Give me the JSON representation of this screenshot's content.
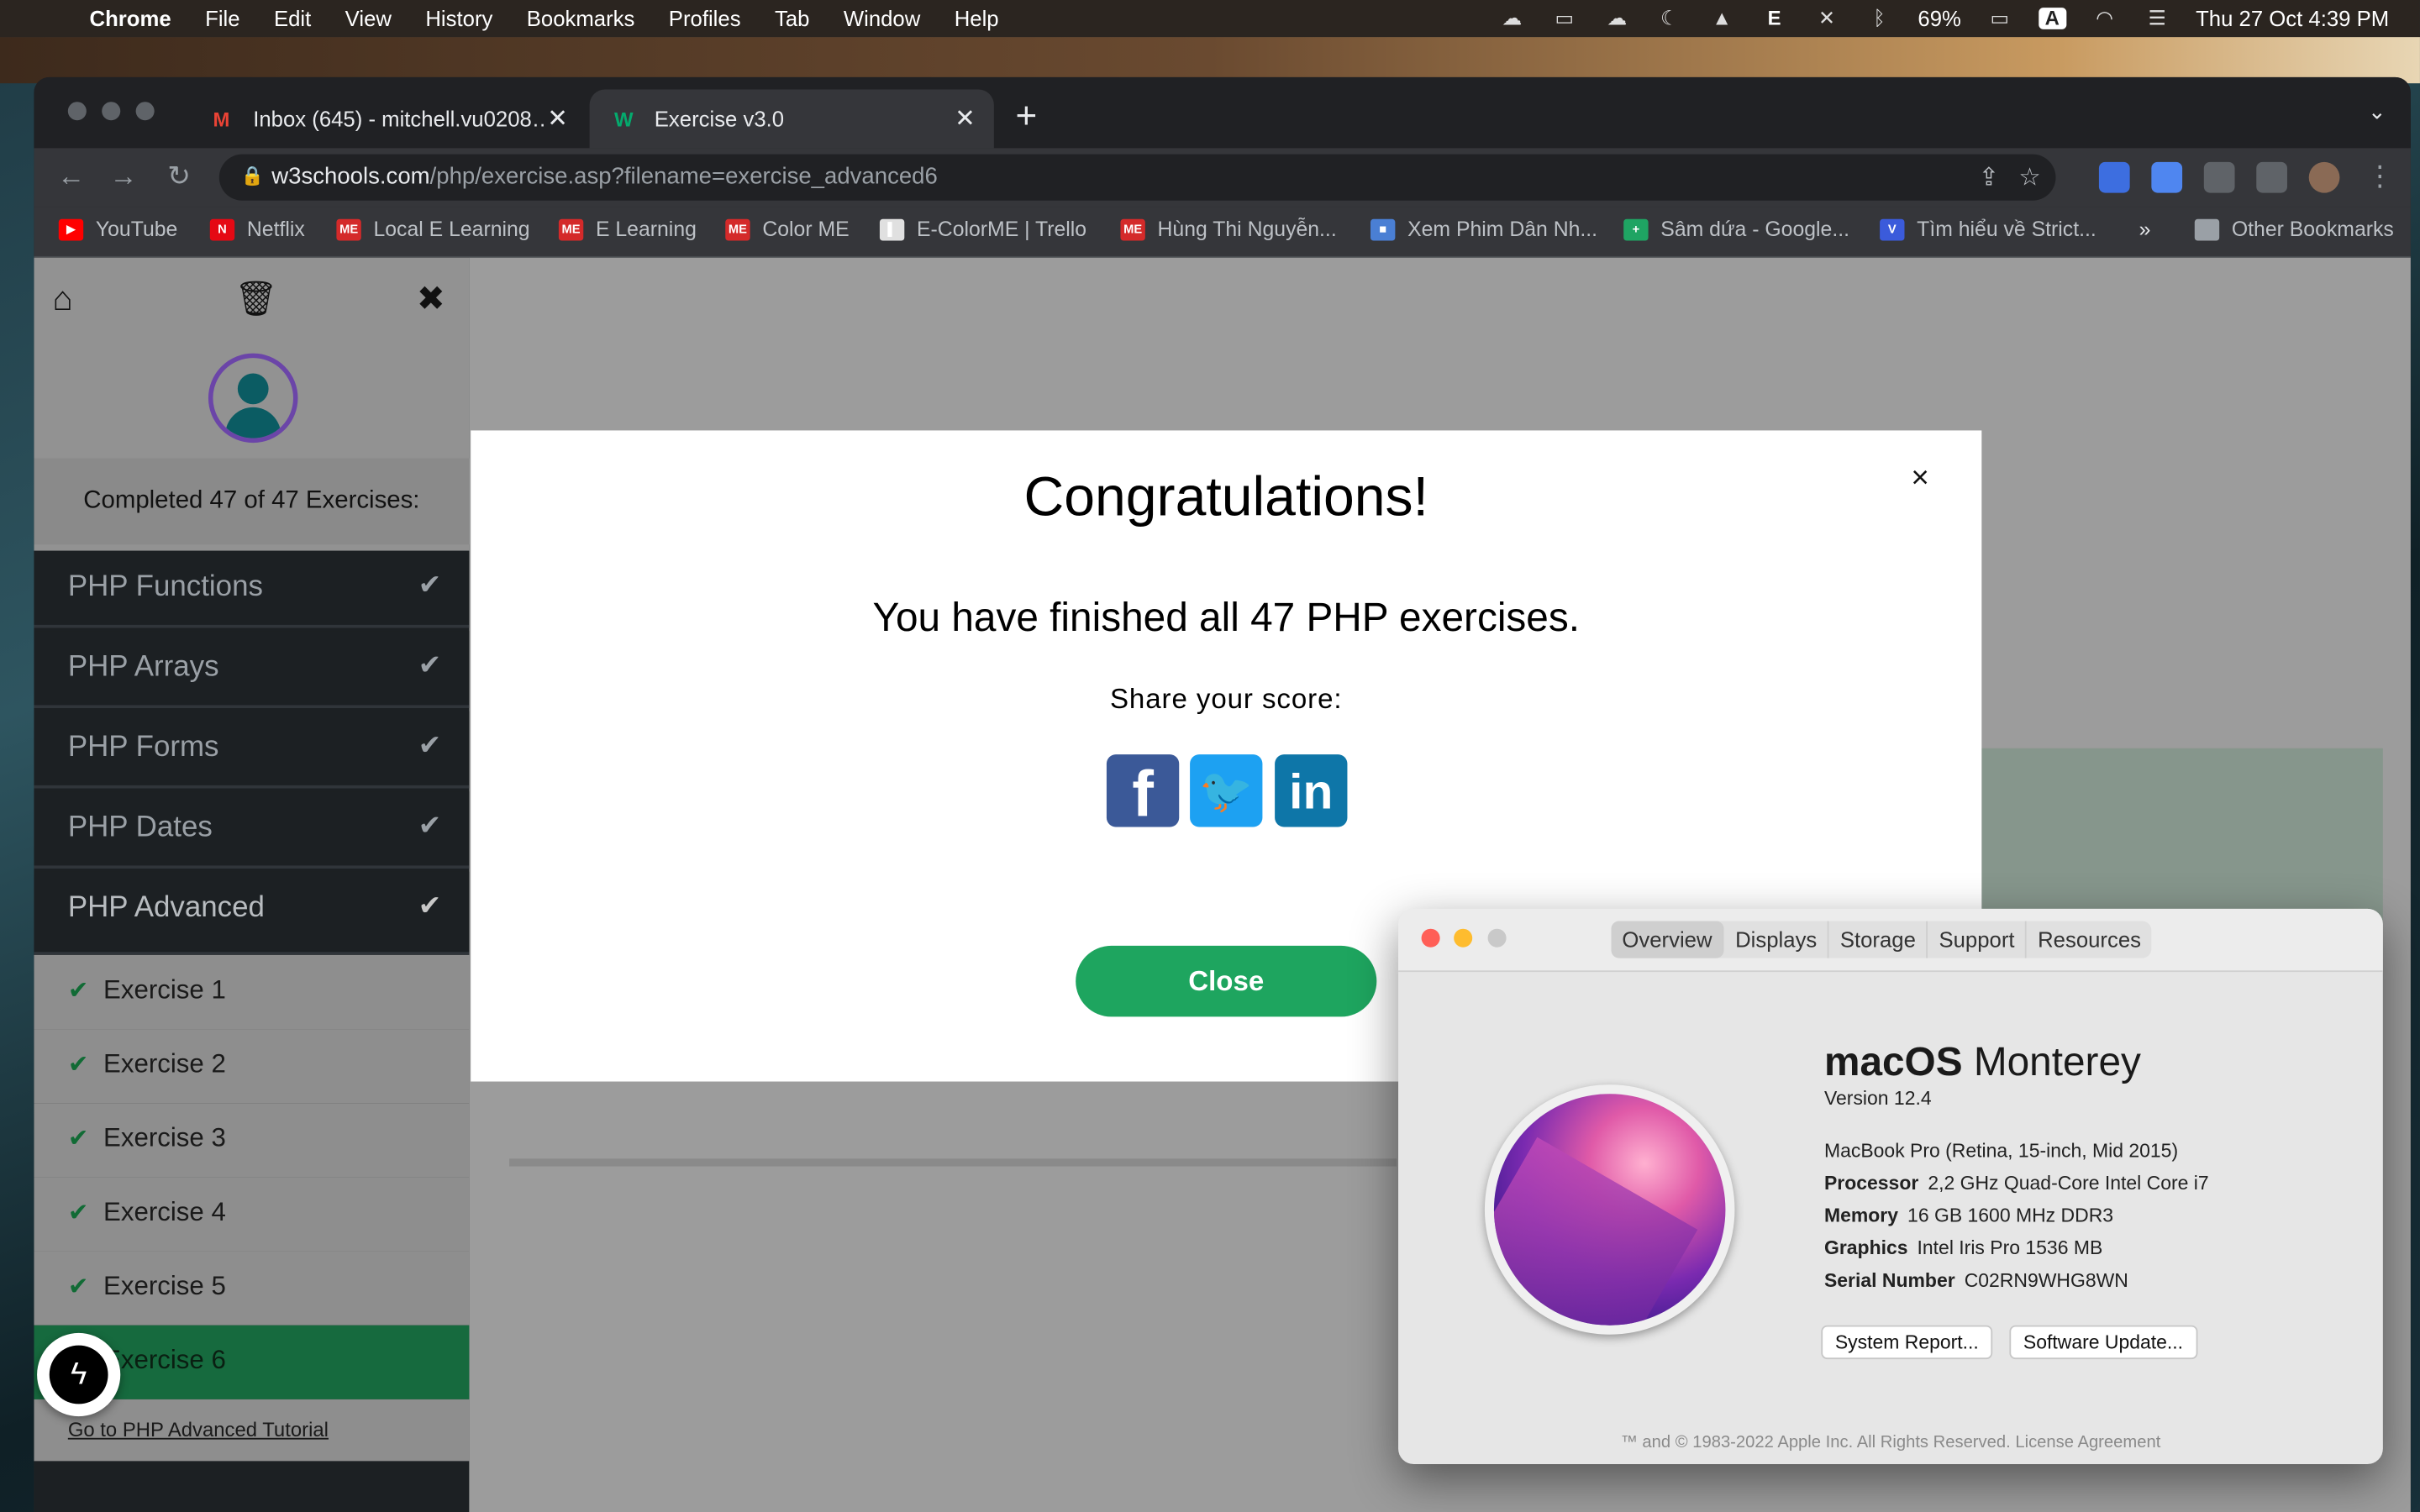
{
  "menubar": {
    "app": "Chrome",
    "items": [
      "File",
      "Edit",
      "View",
      "History",
      "Bookmarks",
      "Profiles",
      "Tab",
      "Window",
      "Help"
    ],
    "battery": "69%",
    "clock": "Thu 27 Oct  4:39 PM"
  },
  "tabs": [
    {
      "title": "Inbox (645) - mitchell.vu0208…",
      "icon": "gmail-icon"
    },
    {
      "title": "Exercise v3.0",
      "icon": "w3schools-icon"
    }
  ],
  "address": {
    "host": "w3schools.com",
    "path": "/php/exercise.asp?filename=exercise_advanced6"
  },
  "bookmarks": [
    {
      "label": "YouTube",
      "color": "#ff0000",
      "glyph": "▶"
    },
    {
      "label": "Netflix",
      "color": "#e50914",
      "glyph": "N"
    },
    {
      "label": "Local E Learning",
      "color": "#d42a2a",
      "glyph": "ME"
    },
    {
      "label": "E Learning",
      "color": "#d42a2a",
      "glyph": "ME"
    },
    {
      "label": "Color ME",
      "color": "#d42a2a",
      "glyph": "ME"
    },
    {
      "label": "E-ColorME | Trello",
      "color": "#e0e0e0",
      "glyph": "▌"
    },
    {
      "label": "Hùng Thi Nguyễn...",
      "color": "#d42a2a",
      "glyph": "ME"
    },
    {
      "label": "Xem Phim Dân Nh...",
      "color": "#4a7fd4",
      "glyph": "■"
    },
    {
      "label": "Sâm dứa - Google...",
      "color": "#1fa463",
      "glyph": "+"
    },
    {
      "label": "Tìm hiểu về Strict...",
      "color": "#3b5bdb",
      "glyph": "V"
    }
  ],
  "other_bookmarks": "Other Bookmarks",
  "sidebar": {
    "completed": "Completed 47 of 47 Exercises:",
    "categories": [
      "PHP Functions",
      "PHP Arrays",
      "PHP Forms",
      "PHP Dates",
      "PHP Advanced"
    ],
    "exercises": [
      "Exercise 1",
      "Exercise 2",
      "Exercise 3",
      "Exercise 4",
      "Exercise 5",
      "Exercise 6"
    ],
    "tutorial_link": "Go to PHP Advanced Tutorial"
  },
  "modal": {
    "title": "Congratulations!",
    "message": "You have finished all 47 PHP exercises.",
    "share": "Share your score:",
    "close": "Close",
    "close_x": "×",
    "social": {
      "facebook": "f",
      "twitter": "🐦",
      "linkedin": "in"
    }
  },
  "about": {
    "tabs": [
      "Overview",
      "Displays",
      "Storage",
      "Support",
      "Resources"
    ],
    "os_bold": "macOS",
    "os_light": " Monterey",
    "version": "Version 12.4",
    "model": "MacBook Pro (Retina, 15-inch, Mid 2015)",
    "specs": [
      {
        "label": "Processor",
        "value": "2,2 GHz Quad-Core Intel Core i7"
      },
      {
        "label": "Memory",
        "value": "16 GB 1600 MHz DDR3"
      },
      {
        "label": "Graphics",
        "value": "Intel Iris Pro 1536 MB"
      },
      {
        "label": "Serial Number",
        "value": "C02RN9WHG8WN"
      }
    ],
    "buttons": [
      "System Report...",
      "Software Update..."
    ],
    "legal": "™ and © 1983-2022 Apple Inc. All Rights Reserved. License Agreement"
  },
  "colors": {
    "accent_green": "#1ea55f",
    "active_exercise": "#166a3e",
    "avatar_ring": "#6b45a8"
  }
}
